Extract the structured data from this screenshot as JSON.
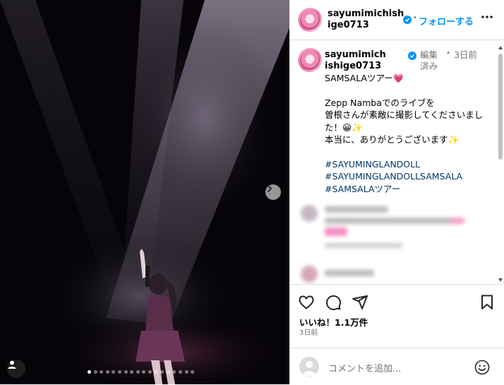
{
  "post": {
    "username": "sayumimichishige0713",
    "follow_label": "フォローする",
    "separator": "•",
    "carousel_dots": 18,
    "active_dot": 0
  },
  "comment": {
    "username": "sayumimichishige0713",
    "edited": "編集済み",
    "separator": "•",
    "time": "3日前",
    "caption_line1": "SAMSALAツアー💗",
    "caption_line2": "Zepp Nambaでのライブを",
    "caption_line3": "曽根さんが素敵に撮影してくださいました！😀✨",
    "caption_line4": "本当に、ありがとうございます✨",
    "hashtags": [
      "#SAYUMINGLANDOLL",
      "#SAYUMINGLANDOLLSAMSALA",
      "#SAMSALAツアー"
    ]
  },
  "footer": {
    "likes": "いいね！1.1万件",
    "date": "3日前",
    "comment_placeholder": "コメントを追加..."
  },
  "colors": {
    "accent": "#0095f6",
    "hashtag": "#00376b",
    "muted": "#737373"
  }
}
